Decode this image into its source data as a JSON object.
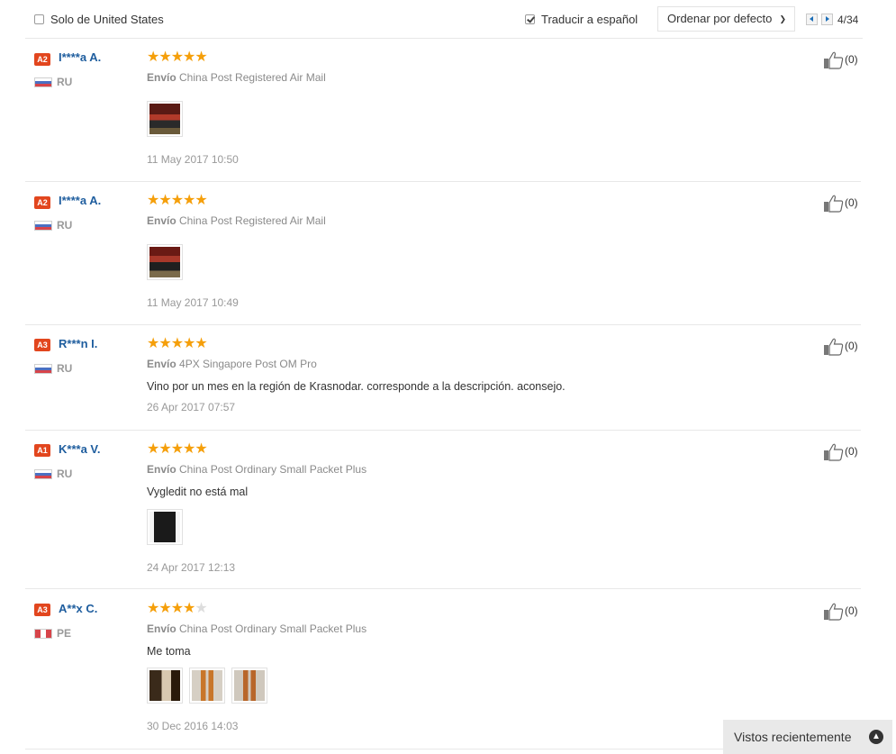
{
  "filters": {
    "only_country_label": "Solo de United States",
    "translate_label": "Traducir a español",
    "sort_label": "Ordenar por defecto",
    "page_indicator": "4/34"
  },
  "reviews": [
    {
      "level": "A2",
      "name": "I****a A.",
      "country": "RU",
      "stars": 5,
      "ship_label": "Envío",
      "ship_method": "China Post Registered Air Mail",
      "text": "",
      "date": "11 May 2017 10:50",
      "helpful": "(0)"
    },
    {
      "level": "A2",
      "name": "I****a A.",
      "country": "RU",
      "stars": 5,
      "ship_label": "Envío",
      "ship_method": "China Post Registered Air Mail",
      "text": "",
      "date": "11 May 2017 10:49",
      "helpful": "(0)"
    },
    {
      "level": "A3",
      "name": "R***n I.",
      "country": "RU",
      "stars": 5,
      "ship_label": "Envío",
      "ship_method": "4PX Singapore Post OM Pro",
      "text": "Vino por un mes en la región de Krasnodar. corresponde a la descripción. aconsejo.",
      "date": "26 Apr 2017 07:57",
      "helpful": "(0)"
    },
    {
      "level": "A1",
      "name": "K***a V.",
      "country": "RU",
      "stars": 5,
      "ship_label": "Envío",
      "ship_method": "China Post Ordinary Small Packet Plus",
      "text": "Vygledit no está mal",
      "date": "24 Apr 2017 12:13",
      "helpful": "(0)"
    },
    {
      "level": "A3",
      "name": "A**x C.",
      "country": "PE",
      "stars": 4,
      "ship_label": "Envío",
      "ship_method": "China Post Ordinary Small Packet Plus",
      "text": "Me toma",
      "date": "30 Dec 2016 14:03",
      "helpful": "(0)"
    }
  ],
  "recently_viewed": {
    "label": "Vistos recientemente"
  },
  "icons": {
    "star": "star-icon",
    "thumb": "thumbs-up-icon",
    "flag": "flag-icon",
    "chevron": "chevron-down-icon",
    "up": "chevron-up-icon"
  },
  "colors": {
    "star": "#f59f0a",
    "username": "#1e5d9e",
    "level_badge": "#e2461e"
  }
}
